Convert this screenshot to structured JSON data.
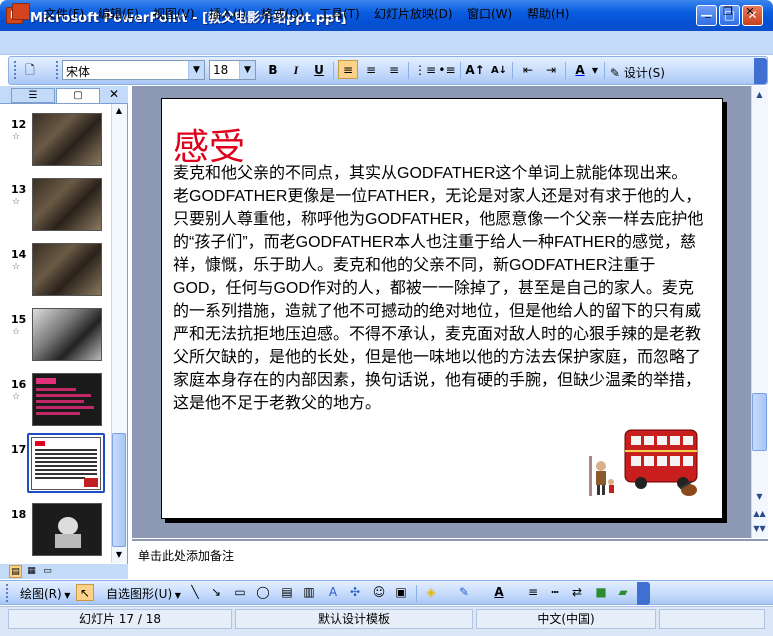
{
  "window": {
    "title": "Microsoft PowerPoint - [教父电影介绍ppt.ppt]",
    "buttons": {
      "minimize": "—",
      "maximize": "□",
      "close": "✕"
    }
  },
  "menu": {
    "items": [
      "文件(F)",
      "编辑(E)",
      "视图(V)",
      "插入(I)",
      "格式(O)",
      "工具(T)",
      "幻灯片放映(D)",
      "窗口(W)",
      "帮助(H)"
    ],
    "doc_buttons": {
      "minimize": "_",
      "restore": "❐",
      "close": "✕"
    }
  },
  "toolbar": {
    "font": "宋体",
    "size": "18",
    "bold": "B",
    "italic": "I",
    "underline": "U",
    "font_color": "A",
    "design_label": "设计(S)"
  },
  "left_pane": {
    "slides": [
      {
        "number": "12",
        "star": "☆",
        "kind": "photo"
      },
      {
        "number": "13",
        "star": "☆",
        "kind": "photo"
      },
      {
        "number": "14",
        "star": "☆",
        "kind": "photo"
      },
      {
        "number": "15",
        "star": "☆",
        "kind": "bw"
      },
      {
        "number": "16",
        "star": "☆",
        "kind": "pink"
      },
      {
        "number": "17",
        "star": "",
        "kind": "text",
        "selected": true
      },
      {
        "number": "18",
        "star": "",
        "kind": "dark"
      }
    ],
    "close": "✕"
  },
  "slide": {
    "title": "感受",
    "body": "麦克和他父亲的不同点，其实从GODFATHER这个单词上就能体现出来。\n老GODFATHER更像是一位FATHER，无论是对家人还是对有求于他的人，只要别人尊重他，称呼他为GODFATHER，他愿意像一个父亲一样去庇护他的“孩子们”，而老GODFATHER本人也注重于给人一种FATHER的感觉，慈祥，慷慨，乐于助人。麦克和他的父亲不同，新GODFATHER注重于GOD，任何与GOD作对的人，都被一一除掉了，甚至是自己的家人。麦克的一系列措施，造就了他不可撼动的绝对地位，但是他给人的留下的只有威严和无法抗拒地压迫感。不得不承认，麦克面对敌人时的心狠手辣的是老教父所欠缺的，是他的长处，但是他一味地以他的方法去保护家庭，而忽略了家庭本身存在的内部因素，换句话说，他有硬的手腕，但缺少温柔的举措，这是他不足于老教父的地方。",
    "colors": {
      "title": "#e0001b",
      "background": "#ffffff",
      "workspace": "#8d98b4"
    }
  },
  "notes": {
    "placeholder": "单击此处添加备注"
  },
  "drawing_toolbar": {
    "draw": "绘图(R)",
    "autoshapes": "自选图形(U)"
  },
  "status": {
    "slide": "幻灯片 17 / 18",
    "template": "默认设计模板",
    "language": "中文(中国)"
  },
  "colors": {
    "titlebar": "#0a5de0",
    "menubar": "#c3daf9",
    "accent": "#1e4ec3"
  }
}
